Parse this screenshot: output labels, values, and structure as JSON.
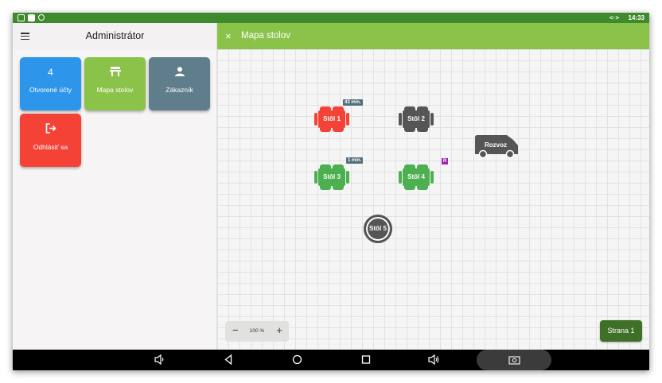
{
  "status_bar": {
    "time": "14:33",
    "arrows": "<·>",
    "icons": [
      "notification-icon",
      "image-icon",
      "location-icon"
    ]
  },
  "sidebar": {
    "title": "Administrátor",
    "tiles": [
      {
        "value": "4",
        "label": "Otvorené účty",
        "color": "#2d96ea"
      },
      {
        "label": "Mapa stolov",
        "icon": "table-icon",
        "color": "#8bc34a"
      },
      {
        "label": "Zákazník",
        "icon": "person-icon",
        "color": "#607d8b"
      },
      {
        "label": "Odhlásiť sa",
        "icon": "logout-icon",
        "color": "#f44336"
      }
    ]
  },
  "header": {
    "close_icon": "×",
    "title": "Mapa stolov",
    "color": "#8bc34a"
  },
  "map": {
    "tables": [
      {
        "name": "Stôl 1",
        "status_color": "#f44336",
        "badge": "43 min."
      },
      {
        "name": "Stôl 2",
        "status_color": "#555555"
      },
      {
        "name": "Stôl 3",
        "status_color": "#4caf50",
        "badge": "1 min."
      },
      {
        "name": "Stôl 4",
        "status_color": "#4caf50",
        "badge": "R"
      },
      {
        "name": "Stôl 5",
        "status_color": "#555555",
        "shape": "round"
      }
    ],
    "delivery": {
      "label": "Rozvoz",
      "icon": "van-icon"
    }
  },
  "zoom": {
    "minus": "−",
    "value": "100 %",
    "plus": "+"
  },
  "page_button": {
    "label": "Strana 1"
  },
  "nav_bar": {
    "icons": [
      "volume-down-icon",
      "back-icon",
      "home-icon",
      "recents-icon",
      "volume-up-icon",
      "screenshot-icon"
    ]
  }
}
